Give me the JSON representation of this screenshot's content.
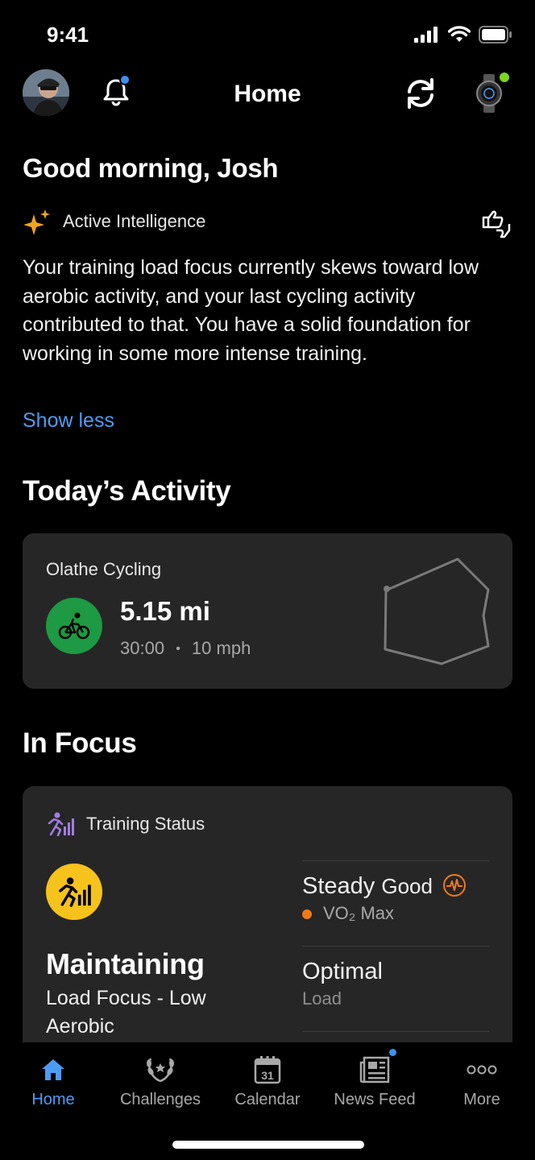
{
  "status_bar": {
    "time": "9:41"
  },
  "header": {
    "title": "Home"
  },
  "greeting": "Good morning, Josh",
  "active_intelligence": {
    "label": "Active Intelligence",
    "body": "Your training load focus currently skews toward low aerobic activity, and your last cycling activity contributed to that. You have a solid foundation for working in some more intense training.",
    "toggle": "Show less"
  },
  "todays_activity": {
    "title": "Today’s Activity",
    "name": "Olathe Cycling",
    "distance": "5.15 mi",
    "duration": "30:00",
    "separator": "•",
    "speed": "10 mph"
  },
  "in_focus": {
    "title": "In Focus",
    "card_label": "Training Status",
    "status": "Maintaining",
    "sub": "Load Focus - Low Aerobic",
    "metrics": [
      {
        "value_a": "Steady",
        "value_b": "Good",
        "label": "VO₂ Max"
      },
      {
        "value": "Optimal",
        "label": "Load"
      }
    ]
  },
  "tabs": [
    {
      "label": "Home"
    },
    {
      "label": "Challenges"
    },
    {
      "label": "Calendar",
      "icon_text": "31"
    },
    {
      "label": "News Feed"
    },
    {
      "label": "More"
    }
  ],
  "colors": {
    "accent": "#4d9cf4",
    "cycling": "#1d9a43",
    "training": "#f6c21c",
    "vo2": "#ef7a1a",
    "notification": "#3d8ff0",
    "watch_connected": "#7ed321"
  }
}
